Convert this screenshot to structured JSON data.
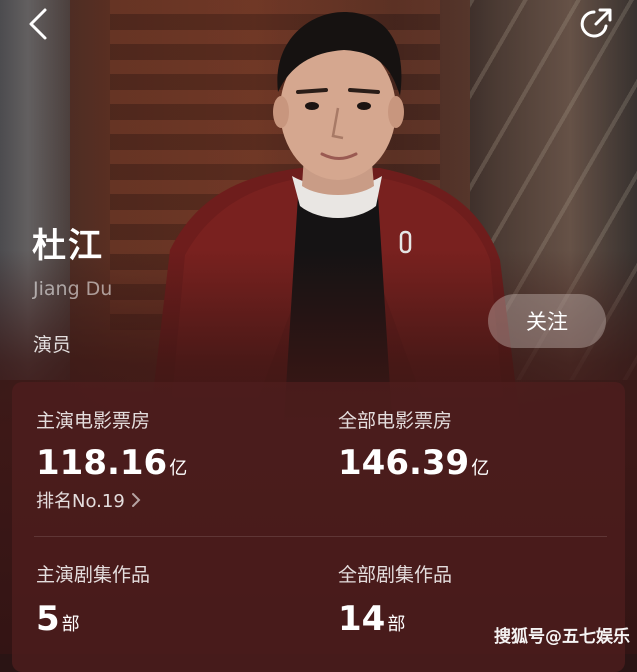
{
  "header": {
    "back_icon": "chevron-left-icon",
    "share_icon": "share-icon"
  },
  "profile": {
    "name": "杜江",
    "name_en": "Jiang Du",
    "role": "演员",
    "follow_label": "关注"
  },
  "stats": {
    "lead_box_office": {
      "label": "主演电影票房",
      "value": "118.16",
      "unit": "亿"
    },
    "rank": {
      "label": "排名No.19"
    },
    "total_box_office": {
      "label": "全部电影票房",
      "value": "146.39",
      "unit": "亿"
    },
    "lead_series": {
      "label": "主演剧集作品",
      "value": "5",
      "unit": "部"
    },
    "total_series": {
      "label": "全部剧集作品",
      "value": "14",
      "unit": "部"
    }
  },
  "watermark": "搜狐号@五七娱乐"
}
